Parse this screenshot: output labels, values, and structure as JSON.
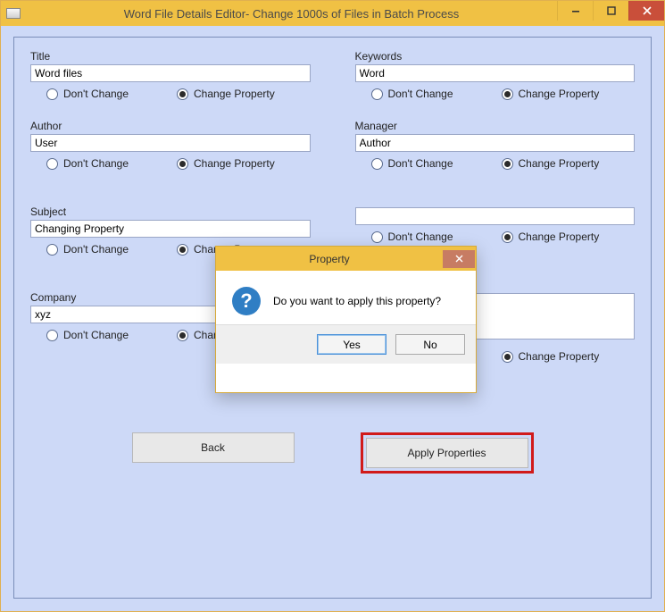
{
  "window": {
    "title": "Word File Details Editor- Change 1000s of Files in Batch Process"
  },
  "labels": {
    "dont_change": "Don't Change",
    "change_property": "Change Property"
  },
  "fields": {
    "title": {
      "label": "Title",
      "value": "Word files",
      "selected": "change"
    },
    "keywords": {
      "label": "Keywords",
      "value": "Word",
      "selected": "change"
    },
    "author": {
      "label": "Author",
      "value": "User",
      "selected": "change"
    },
    "manager": {
      "label": "Manager",
      "value": "Author",
      "selected": "change"
    },
    "subject": {
      "label": "Subject",
      "value": "Changing Property",
      "selected": "change"
    },
    "category": {
      "label": "",
      "value": "",
      "selected": "change"
    },
    "company": {
      "label": "Company",
      "value": "xyz",
      "selected": "change"
    },
    "comments": {
      "label": "",
      "value": "",
      "selected": "change"
    }
  },
  "buttons": {
    "back": "Back",
    "apply": "Apply Properties"
  },
  "dialog": {
    "title": "Property",
    "message": "Do you want to apply this property?",
    "yes": "Yes",
    "no": "No"
  }
}
